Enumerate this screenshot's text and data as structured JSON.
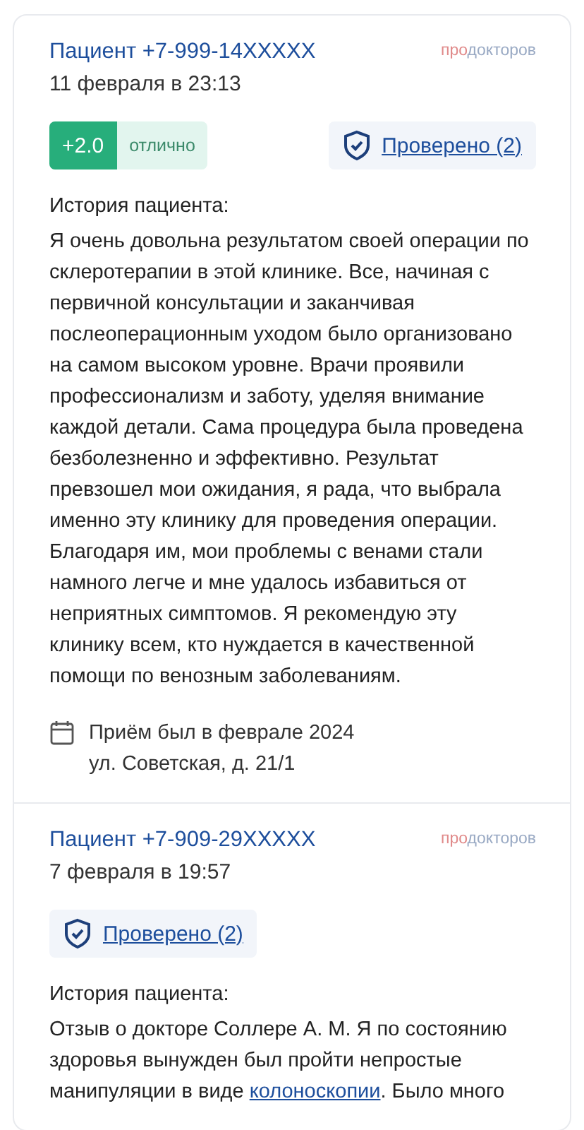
{
  "reviews": [
    {
      "author": "Пациент +7-999-14XXXXX",
      "date": "11 февраля в 23:13",
      "logo": {
        "prefix": "про",
        "rest": "докторов"
      },
      "rating": {
        "score": "+2.0",
        "label": "отлично"
      },
      "verified": "Проверено (2)",
      "story_title": "История пациента:",
      "story": [
        {
          "kind": "plain",
          "text": "Я очень довольна результатом своей операции по склеротерапии в этой клинике. Все, начиная с первичной консультации и заканчивая послеоперационным уходом было организовано на самом высоком уровне. Врачи проявили профессионализм и заботу, уделяя внимание каждой детали. Сама процедура была проведена безболезненно и эффективно. Результат превзошел мои ожидания, я рада, что выбрала именно эту клинику для проведения операции. Благодаря им, мои проблемы с венами стали намного легче и мне удалось избавиться от неприятных симптомов. Я рекомендую эту клинику всем, кто нуждается в качественной помощи по венозным заболеваниям."
        }
      ],
      "visit": "Приём был в феврале 2024",
      "address": "ул. Советская, д. 21/1"
    },
    {
      "author": "Пациент +7-909-29XXXXX",
      "date": "7 февраля в 19:57",
      "logo": {
        "prefix": "про",
        "rest": "докторов"
      },
      "verified": "Проверено (2)",
      "story_title": "История пациента:",
      "story": [
        {
          "kind": "plain",
          "text": "Отзыв о докторе Соллере А. М. Я по состоянию здоровья вынужден был пройти непростые манипуляции в виде "
        },
        {
          "kind": "link",
          "text": "колоноскопии"
        },
        {
          "kind": "plain",
          "text": ". Было много"
        }
      ]
    }
  ]
}
